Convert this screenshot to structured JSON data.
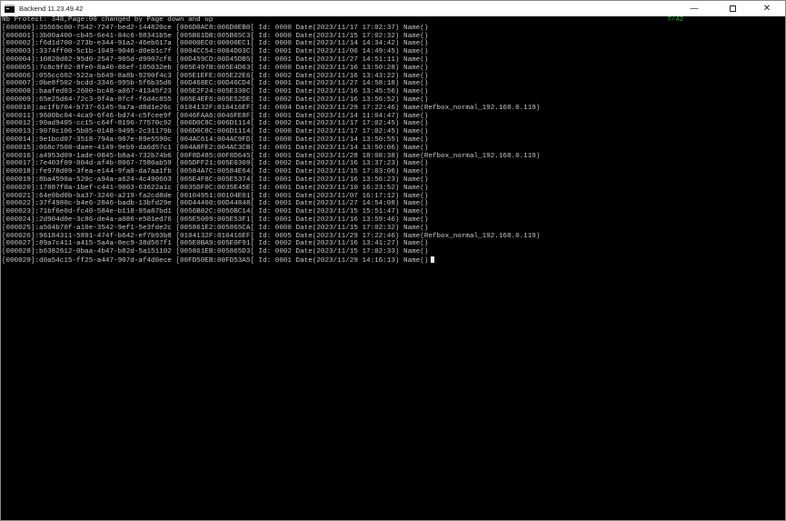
{
  "window": {
    "title": "Backend 11.23.49.42",
    "controls": {
      "minimize": "—",
      "close": "✕"
    }
  },
  "console": {
    "status_line": "Nb Protect: 348,Page:00 changed by Page down and up",
    "page_indicator": "7/42",
    "rows": [
      "[000000]:35569c00-7542-7247-bed2-144820ce [006D0AC8:006D0EB0[ Id: 0000 Date(2023/11/17 17:02:37) Name()",
      "[000001]:3b00a400-cb45-6e41-84c6-98341b5e [005B61DB:005B65C3[ Id: 0000 Date(2023/11/15 17:02:32) Name()",
      "[000002]:f6d1d700-273b-e344-91a2-46eb617a [00000EC0:00000EC1[ Id: 0000 Date(2023/11/14 14:34:42) Name()",
      "[000003]:3374ff00-5c1b-1049-9046-d0eb1c7f [0004CC54:0004D03C[ Id: 0001 Date(2023/11/06 14:49:45) Name()",
      "[000004]:10820d02-95d0-2547-905d-d9907cf6 [00D459CD:00D45DB5[ Id: 0001 Date(2023/11/27 14:51:11) Name()",
      "[000005]:7c8c9f02-8fe0-8a40-86ef-105032eb [005E497B:005E4D63[ Id: 0000 Date(2023/11/16 13:50:28) Name()",
      "[000006]:055cc602-522a-b649-8a8b-9290f4c3 [005E1EFE:005E22E6[ Id: 0002 Date(2023/11/16 13:43:22) Name()",
      "[000007]:0be8f502-bcdd-3346-995b-5f6b35d6 [00D468EC:00D46CD4[ Id: 0001 Date(2023/11/27 14:58:18) Name()",
      "[000008]:baafed03-2600-bc48-a067-41345f23 [005E2F24:005E330C[ Id: 0001 Date(2023/11/16 13:45:56) Name()",
      "[000009]:65e25d04-72c3-9f4a-8fcf-f6d4c855 [005E4EF6:005E52DE[ Id: 0002 Date(2023/11/16 13:56:52) Name()",
      "[000010]:ac1fb704-b737-6145-9a7a-d8d1e26c [0104132F:010416EF[ Id: 0004 Date(2023/11/29 17:22:46) Name(Refbox_normal_192.168.0.119)",
      "[000011]:9600bc04-4ca9-6f46-bd74-c5fcee9f [0046FAA6:0046FE8F[ Id: 0001 Date(2023/11/14 11:04:47) Name()",
      "[000012]:90ad9405-cc15-c64f-8196-77570c92 [006D0C8C:006D1114[ Id: 0002 Date(2023/11/17 17:02:45) Name()",
      "[000013]:9078c106-5b05-0148-9495-2c31179b [006D0C8C:006D1114[ Id: 0000 Date(2023/11/17 17:02:45) Name()",
      "[000014]:9e1bcd07-3518-794a-987e-89e5590c [004AC614:004AC9FD[ Id: 0000 Date(2023/11/14 13:50:55) Name()",
      "[000015]:068c7508-daee-4149-9eb9-da6d57c1 [004A8FE2:004AC3CB[ Id: 0001 Date(2023/11/14 13:50:06) Name()",
      "[000016]:a4953d09-1ade-0845-b8a4-732b74b6 [00F8D485:00F8D645[ Id: 0001 Date(2023/11/28 18:08:38) Name(Refbox_normal_192.168.0.119)",
      "[000017]:7e403f09-004d-af4b-8067-7580ab59 [005DFF21:005E0309[ Id: 0002 Date(2023/11/16 13:37:23) Name()",
      "[000018]:fe978d09-3fea-e144-9fa0-da7aa1fb [00584A7C:00584E64[ Id: 0001 Date(2023/11/15 17:03:06) Name()",
      "[000019]:8ba4590a-520c-a94a-a624-4c490603 [005E4F8C:005E5374[ Id: 0001 Date(2023/11/16 13:56:23) Name()",
      "[000020]:17887f0a-1bef-c441-9003-63622a1c [0035DF0C:0035E45E[ Id: 0001 Date(2023/11/10 16:23:52) Name()",
      "[000021]:64e0bd0b-ba37-3240-a219-fa2cd8de [00104951:00104E01[ Id: 0001 Date(2023/11/07 16:17:12) Name()",
      "[000022]:37f4980c-b4e6-2846-badb-13bfd29e [00D44460:00D44848[ Id: 0001 Date(2023/11/27 14:54:08) Name()",
      "[000023]:71bf6e0d-fc40-584e-b118-95a87bd1 [0056B82C:0056BC14[ Id: 0001 Date(2023/11/15 15:51:47) Name()",
      "[000024]:2d904d0e-3c86-de4a-a086-e501ed76 [005E5009:005E53F1[ Id: 0001 Date(2023/11/16 13:59:46) Name()",
      "[000025]:a504b70f-a10e-3542-9ef1-5e3fde2c [005861E2:005865CA[ Id: 0000 Date(2023/11/15 17:02:32) Name()",
      "[000026]:96184311-5891-474f-b642-ef7b93b8 [0104132F:010416EF[ Id: 0005 Date(2023/11/29 17:22:46) Name(Refbox_normal_192.168.0.119)",
      "[000027]:89a7c411-a415-5a4a-8ec9-38d567f1 [005E0BA9:005E0F91[ Id: 0002 Date(2023/11/16 13:41:27) Name()",
      "[000028]:b6382612-0baa-4b47-b82d-5a151102 [005861EB:005865D3[ Id: 0002 Date(2023/11/15 17:02:33) Name()",
      "[000029]:d0a54c15-ff25-a447-907d-af4d0ece [00FD50EB:00FD53A5[ Id: 0001 Date(2023/11/29 14:16:13) Name()"
    ]
  }
}
